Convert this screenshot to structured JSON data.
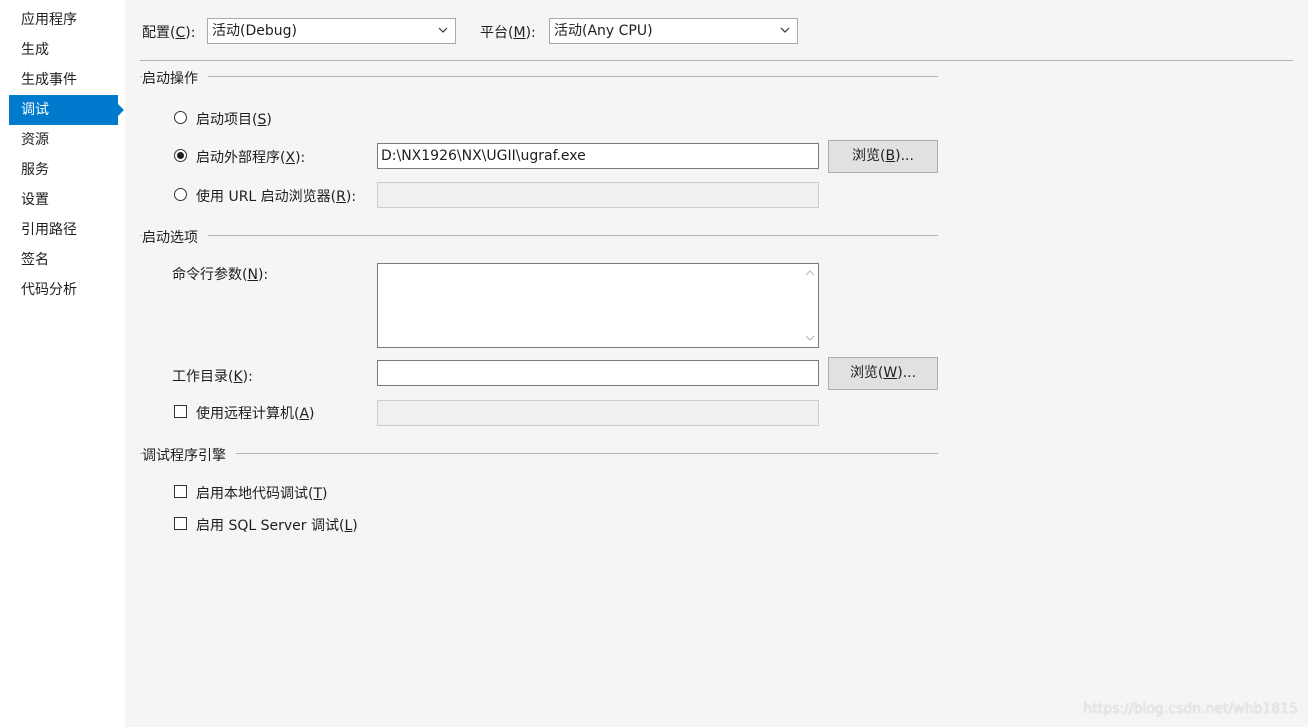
{
  "sidebar": {
    "items": [
      {
        "label": "应用程序"
      },
      {
        "label": "生成"
      },
      {
        "label": "生成事件"
      },
      {
        "label": "调试",
        "active": true
      },
      {
        "label": "资源"
      },
      {
        "label": "服务"
      },
      {
        "label": "设置"
      },
      {
        "label": "引用路径"
      },
      {
        "label": "签名"
      },
      {
        "label": "代码分析"
      }
    ]
  },
  "config": {
    "label_pre": "配置(",
    "label_key": "C",
    "label_post": "):",
    "value": "活动(Debug)"
  },
  "platform": {
    "label_pre": "平台(",
    "label_key": "M",
    "label_post": "):",
    "value": "活动(Any CPU)"
  },
  "start_action": {
    "title": "启动操作",
    "project": {
      "pre": "启动项目(",
      "key": "S",
      "post": ")"
    },
    "external": {
      "pre": "启动外部程序(",
      "key": "X",
      "post": "):",
      "value": "D:\\NX1926\\NX\\UGII\\ugraf.exe"
    },
    "url": {
      "pre": "使用 URL 启动浏览器(",
      "key": "R",
      "post": "):"
    },
    "browse": {
      "pre": "浏览(",
      "key": "B",
      "post": ")..."
    },
    "selected": "external"
  },
  "start_options": {
    "title": "启动选项",
    "args": {
      "pre": "命令行参数(",
      "key": "N",
      "post": "):"
    },
    "workdir": {
      "pre": "工作目录(",
      "key": "K",
      "post": "):"
    },
    "browse": {
      "pre": "浏览(",
      "key": "W",
      "post": ")..."
    },
    "remote": {
      "pre": "使用远程计算机(",
      "key": "A",
      "post": ")"
    }
  },
  "debugger_engines": {
    "title": "调试程序引擎",
    "native": {
      "pre": "启用本地代码调试(",
      "key": "T",
      "post": ")"
    },
    "sql": {
      "pre": "启用 SQL Server 调试(",
      "key": "L",
      "post": ")"
    }
  },
  "watermark": "https://blog.csdn.net/whb1815",
  "colors": {
    "accent": "#007acc",
    "panel": "#f5f5f5",
    "sidebar": "#ffffff"
  },
  "icons": [
    "chevron-down-icon",
    "chevron-up-icon"
  ]
}
